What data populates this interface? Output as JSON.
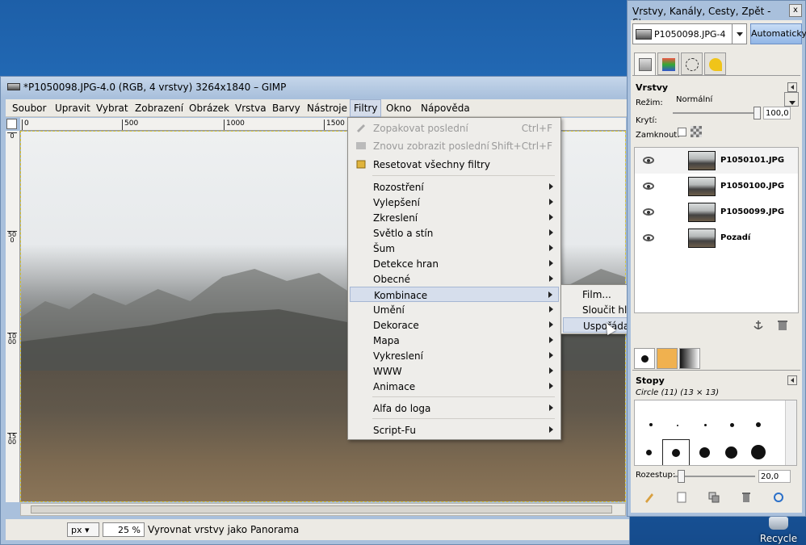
{
  "desktop": {
    "recycle_bin_label": "Recycle Bin"
  },
  "main_window": {
    "title": "*P1050098.JPG-4.0 (RGB, 4 vrstvy) 3264x1840 – GIMP",
    "menu": [
      "Soubor",
      "Upravit",
      "Vybrat",
      "Zobrazení",
      "Obrázek",
      "Vrstva",
      "Barvy",
      "Nástroje",
      "Filtry",
      "Okno",
      "Nápověda"
    ],
    "active_menu": "Filtry",
    "ruler_top_labels": [
      "0",
      "500",
      "1000",
      "1500"
    ],
    "ruler_left_labels": [
      "0",
      "500",
      "1000",
      "1500"
    ],
    "status": {
      "unit": "px",
      "zoom": "25 %",
      "message": "Vyrovnat vrstvy jako Panorama"
    }
  },
  "filters_menu": {
    "items": [
      {
        "label": "Zopakovat poslední",
        "shortcut": "Ctrl+F",
        "disabled": true,
        "icon": "repeat-icon"
      },
      {
        "label": "Znovu zobrazit poslední",
        "shortcut": "Shift+Ctrl+F",
        "disabled": true,
        "icon": "reshow-icon"
      },
      {
        "label": "Resetovat všechny filtry",
        "shortcut": "",
        "disabled": false,
        "icon": "reset-icon"
      },
      {
        "label": "Rozostření",
        "submenu": true
      },
      {
        "label": "Vylepšení",
        "submenu": true
      },
      {
        "label": "Zkreslení",
        "submenu": true
      },
      {
        "label": "Světlo a stín",
        "submenu": true
      },
      {
        "label": "Šum",
        "submenu": true
      },
      {
        "label": "Detekce hran",
        "submenu": true
      },
      {
        "label": "Obecné",
        "submenu": true
      },
      {
        "label": "Kombinace",
        "submenu": true,
        "highlighted": true
      },
      {
        "label": "Umění",
        "submenu": true
      },
      {
        "label": "Dekorace",
        "submenu": true
      },
      {
        "label": "Mapa",
        "submenu": true
      },
      {
        "label": "Vykreslení",
        "submenu": true
      },
      {
        "label": "WWW",
        "submenu": true
      },
      {
        "label": "Animace",
        "submenu": true
      },
      {
        "label": "Alfa do loga",
        "submenu": true
      },
      {
        "label": "Script-Fu",
        "submenu": true
      }
    ]
  },
  "combine_submenu": {
    "items": [
      "Film...",
      "Sloučit hloubku...",
      "Uspořádat jako Panorama..."
    ],
    "highlighted": "Uspořádat jako Panorama..."
  },
  "dock": {
    "title": "Vrstvy, Kanály, Cesty, Zpět - Stopy,...",
    "close": "x",
    "image_selector": "P1050098.JPG-4",
    "auto_button": "Automaticky",
    "tabs": [
      "layers-icon",
      "channels-icon",
      "paths-icon",
      "undo-icon"
    ],
    "layers": {
      "title": "Vrstvy",
      "mode_label": "Režim:",
      "mode_value": "Normální",
      "opacity_label": "Krytí:",
      "opacity_value": "100,0",
      "opacity": 1.0,
      "lock_label": "Zamknout:",
      "list": [
        {
          "name": "P1050101.JPG",
          "active": true
        },
        {
          "name": "P1050100.JPG",
          "active": false
        },
        {
          "name": "P1050099.JPG",
          "active": false
        },
        {
          "name": "Pozadí",
          "active": false
        }
      ]
    },
    "brushes": {
      "title": "Stopy",
      "current": "Circle (11) (13 × 13)",
      "spacing_label": "Rozestup:",
      "spacing_value": "20,0"
    }
  },
  "colors": {
    "menu_highlight": "#d6deec",
    "window_frame": "#a9c0dc",
    "auto_button": "#91b6e6"
  }
}
